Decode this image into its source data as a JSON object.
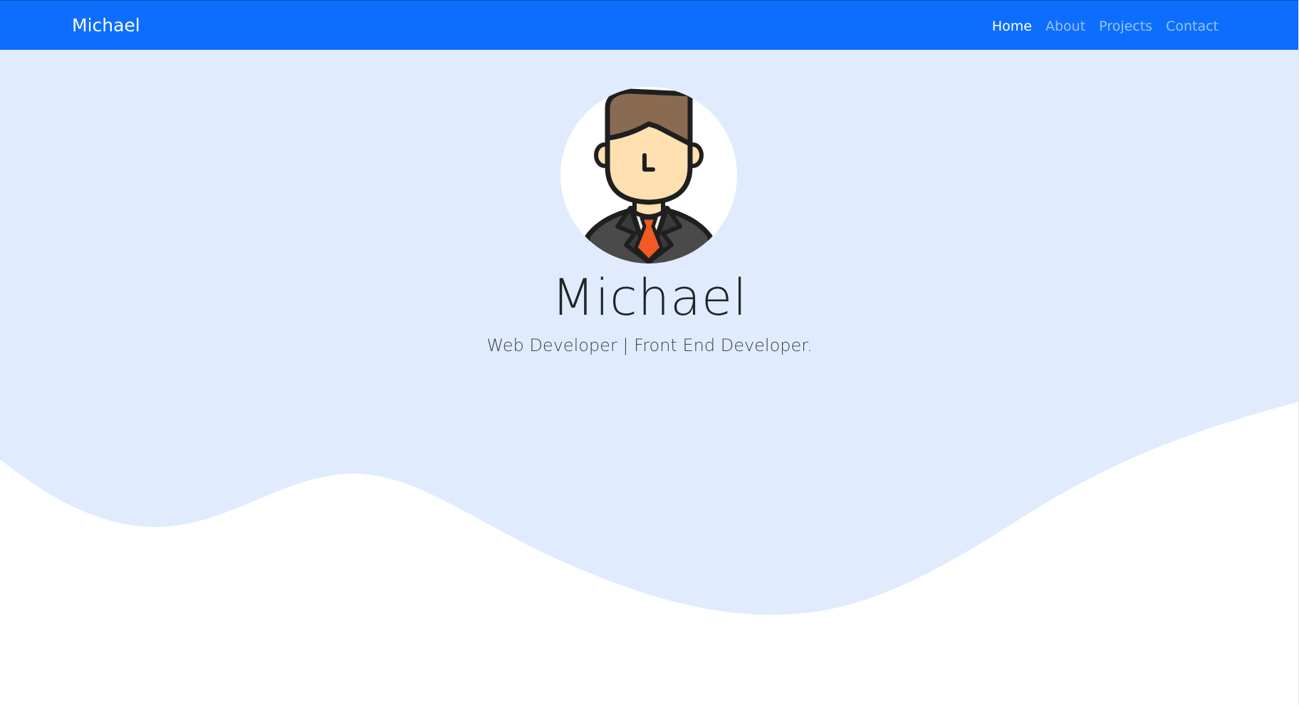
{
  "navbar": {
    "brand": "Michael",
    "links": [
      {
        "label": "Home",
        "active": true
      },
      {
        "label": "About",
        "active": false
      },
      {
        "label": "Projects",
        "active": false
      },
      {
        "label": "Contact",
        "active": false
      }
    ]
  },
  "hero": {
    "avatar_icon": "businessman-avatar-icon",
    "name": "Michael",
    "subtitle": "Web Developer | Front End Developer."
  },
  "colors": {
    "navbar_bg": "#0d6efd",
    "hero_bg": "#e0ecfd",
    "page_bg": "#ffffff",
    "tie": "#f15a22",
    "hair": "#8b6a52",
    "skin": "#ffe0b0"
  }
}
